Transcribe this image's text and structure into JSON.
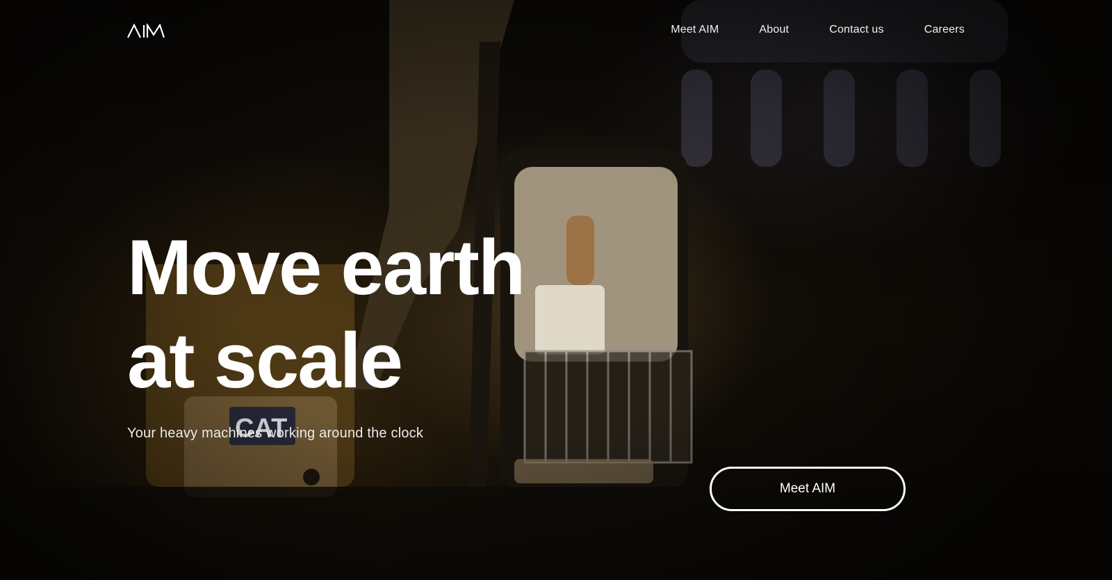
{
  "brand": {
    "logo_text": "AIM",
    "logo_icon": "aim-logo-icon"
  },
  "nav": {
    "items": [
      {
        "label": "Meet AIM"
      },
      {
        "label": "About"
      },
      {
        "label": "Contact us"
      },
      {
        "label": "Careers"
      }
    ]
  },
  "hero": {
    "title_line1": "Move earth",
    "title_line2": "at scale",
    "subtitle": "Your heavy machines working around the clock",
    "cta_label": "Meet AIM",
    "background_image": "excavator-at-night-photo",
    "machine_badge": "CAT"
  },
  "colors": {
    "text": "#ffffff",
    "background": "#0a0806"
  }
}
